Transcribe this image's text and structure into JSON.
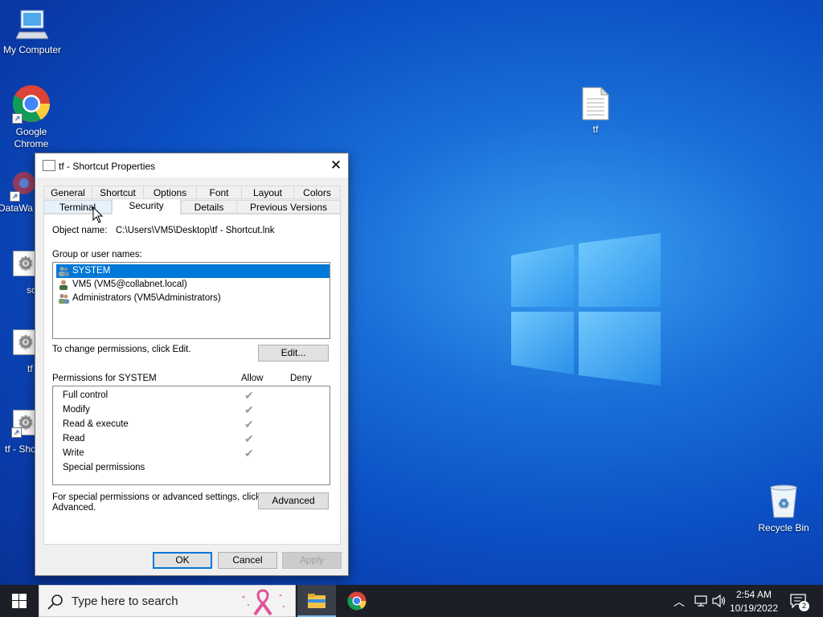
{
  "desktop": {
    "icons": [
      {
        "label": "My Computer"
      },
      {
        "label": "Google Chrome"
      },
      {
        "label": "DataWa"
      },
      {
        "label": "sc"
      },
      {
        "label": "tf"
      },
      {
        "label": "tf - Sho"
      },
      {
        "label": "tf"
      },
      {
        "label": "Recycle Bin"
      }
    ]
  },
  "dialog": {
    "title": "tf - Shortcut Properties",
    "tabs_row1": [
      "General",
      "Shortcut",
      "Options",
      "Font",
      "Layout",
      "Colors"
    ],
    "tabs_row2": [
      "Terminal",
      "Security",
      "Details",
      "Previous Versions"
    ],
    "active_tab": "Security",
    "object_name_label": "Object name:",
    "object_name_value": "C:\\Users\\VM5\\Desktop\\tf - Shortcut.lnk",
    "group_label": "Group or user names:",
    "users": [
      {
        "name": "SYSTEM",
        "selected": true
      },
      {
        "name": "VM5 (VM5@collabnet.local)",
        "selected": false
      },
      {
        "name": "Administrators (VM5\\Administrators)",
        "selected": false
      }
    ],
    "change_text": "To change permissions, click Edit.",
    "edit_button": "Edit...",
    "permissions_for": "Permissions for SYSTEM",
    "allow_header": "Allow",
    "deny_header": "Deny",
    "permissions": [
      {
        "name": "Full control",
        "allow": true
      },
      {
        "name": "Modify",
        "allow": true
      },
      {
        "name": "Read & execute",
        "allow": true
      },
      {
        "name": "Read",
        "allow": true
      },
      {
        "name": "Write",
        "allow": true
      },
      {
        "name": "Special permissions",
        "allow": false
      }
    ],
    "special_text_1": "For special permissions or advanced settings, click",
    "special_text_2": "Advanced.",
    "advanced_button": "Advanced",
    "ok_button": "OK",
    "cancel_button": "Cancel",
    "apply_button": "Apply"
  },
  "taskbar": {
    "search_placeholder": "Type here to search",
    "time": "2:54 AM",
    "date": "10/19/2022",
    "notification_count": "2"
  }
}
